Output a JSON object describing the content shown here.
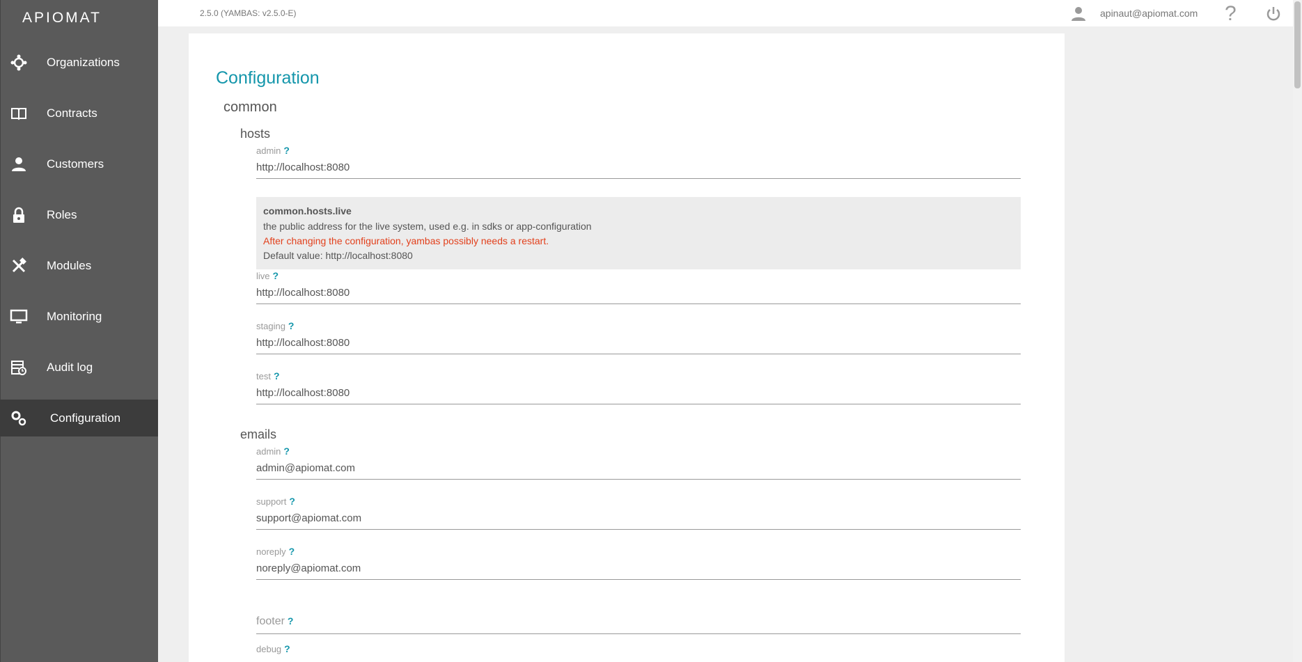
{
  "app": {
    "logo_text": "APIOMAT",
    "version": "2.5.0 (YAMBAS: v2.5.0-E)"
  },
  "user": {
    "email": "apinaut@apiomat.com"
  },
  "sidebar": {
    "items": [
      {
        "label": "Organizations",
        "icon": "organizations-icon"
      },
      {
        "label": "Contracts",
        "icon": "book-icon"
      },
      {
        "label": "Customers",
        "icon": "person-icon"
      },
      {
        "label": "Roles",
        "icon": "lock-icon"
      },
      {
        "label": "Modules",
        "icon": "tools-icon"
      },
      {
        "label": "Monitoring",
        "icon": "monitor-icon"
      },
      {
        "label": "Audit log",
        "icon": "audit-log-icon"
      },
      {
        "label": "Configuration",
        "icon": "gears-icon",
        "active": true
      }
    ]
  },
  "main": {
    "title": "Configuration",
    "section": "common",
    "hosts": {
      "title": "hosts",
      "admin": {
        "label": "admin",
        "value": "http://localhost:8080"
      },
      "tooltip": {
        "key": "common.hosts.live",
        "description": "the public address for the live system, used e.g. in sdks or app-configuration",
        "warning": "After changing the configuration, yambas possibly needs a restart.",
        "default": "Default value: http://localhost:8080"
      },
      "live": {
        "label": "live",
        "value": "http://localhost:8080"
      },
      "staging": {
        "label": "staging",
        "value": "http://localhost:8080"
      },
      "test": {
        "label": "test",
        "value": "http://localhost:8080"
      }
    },
    "emails": {
      "title": "emails",
      "admin": {
        "label": "admin",
        "value": "admin@apiomat.com"
      },
      "support": {
        "label": "support",
        "value": "support@apiomat.com"
      },
      "noreply": {
        "label": "noreply",
        "value": "noreply@apiomat.com"
      }
    },
    "footer": {
      "label": "footer"
    },
    "debug": {
      "label": "debug"
    },
    "help_mark": "?"
  },
  "colors": {
    "accent": "#1496ab",
    "warning": "#e2401c",
    "sidebar": "#5a5a5a",
    "sidebar_active": "#3c3c3c"
  }
}
